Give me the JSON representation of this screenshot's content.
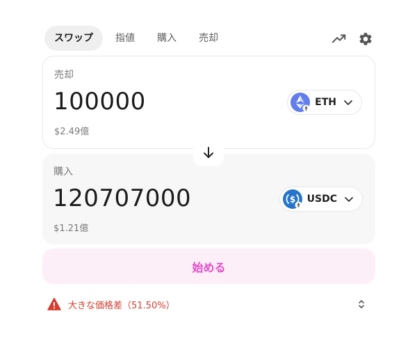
{
  "tabs": [
    {
      "label": "スワップ",
      "active": true
    },
    {
      "label": "指値",
      "active": false
    },
    {
      "label": "購入",
      "active": false
    },
    {
      "label": "売却",
      "active": false
    }
  ],
  "toolbar": {
    "chart_icon": "trending-up-icon",
    "settings_icon": "gear-icon"
  },
  "sell": {
    "label": "売却",
    "amount": "100000",
    "fiat": "$2.49億",
    "token": "ETH",
    "token_icon": "eth-icon"
  },
  "buy": {
    "label": "購入",
    "amount": "120707000",
    "fiat": "$1.21億",
    "token": "USDC",
    "token_icon": "usdc-icon"
  },
  "swap_arrow_icon": "arrow-down-icon",
  "start_button": {
    "label": "始める"
  },
  "warning": {
    "text": "大きな価格差（51.50%）",
    "icon": "warning-triangle-icon"
  },
  "colors": {
    "accent": "#e24cc6",
    "accent_bg": "#fdeff8",
    "warning": "#d43d2f",
    "eth": "#627eea",
    "usdc": "#2775ca"
  }
}
